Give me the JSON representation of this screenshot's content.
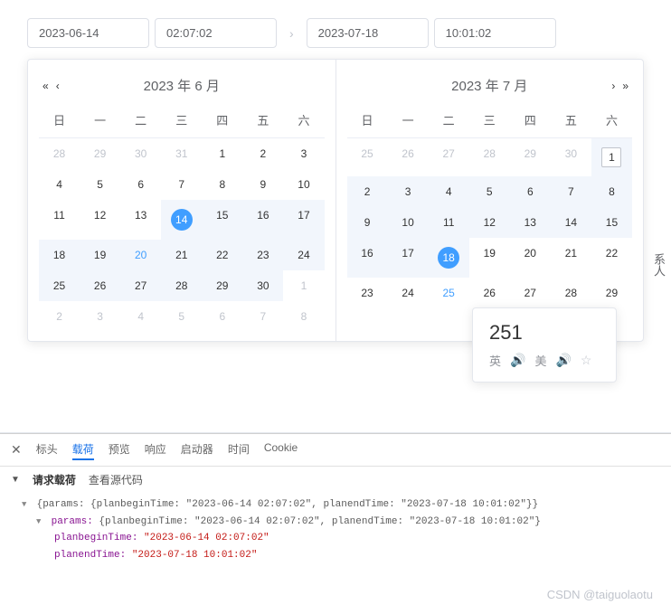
{
  "inputs": {
    "startDate": "2023-06-14",
    "startTime": "02:07:02",
    "endDate": "2023-07-18",
    "endTime": "10:01:02",
    "arrow": "›"
  },
  "calLeft": {
    "title": "2023 年 6 月",
    "navPrevYear": "«",
    "navPrevMonth": "‹",
    "weekdays": [
      "日",
      "一",
      "二",
      "三",
      "四",
      "五",
      "六"
    ],
    "days": [
      {
        "d": "28",
        "cls": "other-month"
      },
      {
        "d": "29",
        "cls": "other-month"
      },
      {
        "d": "30",
        "cls": "other-month"
      },
      {
        "d": "31",
        "cls": "other-month"
      },
      {
        "d": "1"
      },
      {
        "d": "2"
      },
      {
        "d": "3"
      },
      {
        "d": "4"
      },
      {
        "d": "5"
      },
      {
        "d": "6"
      },
      {
        "d": "7"
      },
      {
        "d": "8"
      },
      {
        "d": "9"
      },
      {
        "d": "10"
      },
      {
        "d": "11"
      },
      {
        "d": "12"
      },
      {
        "d": "13"
      },
      {
        "d": "14",
        "cls": "selected in-range"
      },
      {
        "d": "15",
        "cls": "in-range"
      },
      {
        "d": "16",
        "cls": "in-range"
      },
      {
        "d": "17",
        "cls": "in-range"
      },
      {
        "d": "18",
        "cls": "in-range"
      },
      {
        "d": "19",
        "cls": "in-range"
      },
      {
        "d": "20",
        "cls": "in-range today"
      },
      {
        "d": "21",
        "cls": "in-range"
      },
      {
        "d": "22",
        "cls": "in-range"
      },
      {
        "d": "23",
        "cls": "in-range"
      },
      {
        "d": "24",
        "cls": "in-range"
      },
      {
        "d": "25",
        "cls": "in-range"
      },
      {
        "d": "26",
        "cls": "in-range"
      },
      {
        "d": "27",
        "cls": "in-range"
      },
      {
        "d": "28",
        "cls": "in-range"
      },
      {
        "d": "29",
        "cls": "in-range"
      },
      {
        "d": "30",
        "cls": "in-range"
      },
      {
        "d": "1",
        "cls": "other-month"
      },
      {
        "d": "2",
        "cls": "other-month"
      },
      {
        "d": "3",
        "cls": "other-month"
      },
      {
        "d": "4",
        "cls": "other-month"
      },
      {
        "d": "5",
        "cls": "other-month"
      },
      {
        "d": "6",
        "cls": "other-month"
      },
      {
        "d": "7",
        "cls": "other-month"
      },
      {
        "d": "8",
        "cls": "other-month"
      }
    ]
  },
  "calRight": {
    "title": "2023 年 7 月",
    "navNextMonth": "›",
    "navNextYear": "»",
    "weekdays": [
      "日",
      "一",
      "二",
      "三",
      "四",
      "五",
      "六"
    ],
    "days": [
      {
        "d": "25",
        "cls": "other-month"
      },
      {
        "d": "26",
        "cls": "other-month"
      },
      {
        "d": "27",
        "cls": "other-month"
      },
      {
        "d": "28",
        "cls": "other-month"
      },
      {
        "d": "29",
        "cls": "other-month"
      },
      {
        "d": "30",
        "cls": "other-month"
      },
      {
        "d": "1",
        "cls": "in-range range-end"
      },
      {
        "d": "2",
        "cls": "in-range"
      },
      {
        "d": "3",
        "cls": "in-range"
      },
      {
        "d": "4",
        "cls": "in-range"
      },
      {
        "d": "5",
        "cls": "in-range"
      },
      {
        "d": "6",
        "cls": "in-range"
      },
      {
        "d": "7",
        "cls": "in-range"
      },
      {
        "d": "8",
        "cls": "in-range"
      },
      {
        "d": "9",
        "cls": "in-range"
      },
      {
        "d": "10",
        "cls": "in-range"
      },
      {
        "d": "11",
        "cls": "in-range"
      },
      {
        "d": "12",
        "cls": "in-range"
      },
      {
        "d": "13",
        "cls": "in-range"
      },
      {
        "d": "14",
        "cls": "in-range"
      },
      {
        "d": "15",
        "cls": "in-range"
      },
      {
        "d": "16",
        "cls": "in-range"
      },
      {
        "d": "17",
        "cls": "in-range"
      },
      {
        "d": "18",
        "cls": "selected in-range"
      },
      {
        "d": "19"
      },
      {
        "d": "20"
      },
      {
        "d": "21"
      },
      {
        "d": "22"
      },
      {
        "d": "23"
      },
      {
        "d": "24"
      },
      {
        "d": "25",
        "cls": "today"
      },
      {
        "d": "26"
      },
      {
        "d": "27"
      },
      {
        "d": "28"
      },
      {
        "d": "29"
      }
    ]
  },
  "tooltip": {
    "number": "251",
    "lang1": "英",
    "lang2": "美"
  },
  "sidebar": {
    "contact": "系人"
  },
  "devtools": {
    "tabs": [
      "标头",
      "载荷",
      "预览",
      "响应",
      "启动器",
      "时间",
      "Cookie"
    ],
    "activeTab": 1,
    "subheader": "请求载荷",
    "viewSource": "查看源代码",
    "line1_pre": "{params: {planbeginTime: ",
    "line1_v1": "\"2023-06-14 02:07:02\"",
    "line1_mid": ", planendTime: ",
    "line1_v2": "\"2023-07-18 10:01:02\"",
    "line1_post": "}}",
    "line2_pre": "params: ",
    "line2_body": "{planbeginTime: \"2023-06-14 02:07:02\", planendTime: \"2023-07-18 10:01:02\"}",
    "k1": "planbeginTime: ",
    "v1": "\"2023-06-14 02:07:02\"",
    "k2": "planendTime: ",
    "v2": "\"2023-07-18 10:01:02\""
  },
  "watermark": "CSDN @taiguolaotu"
}
